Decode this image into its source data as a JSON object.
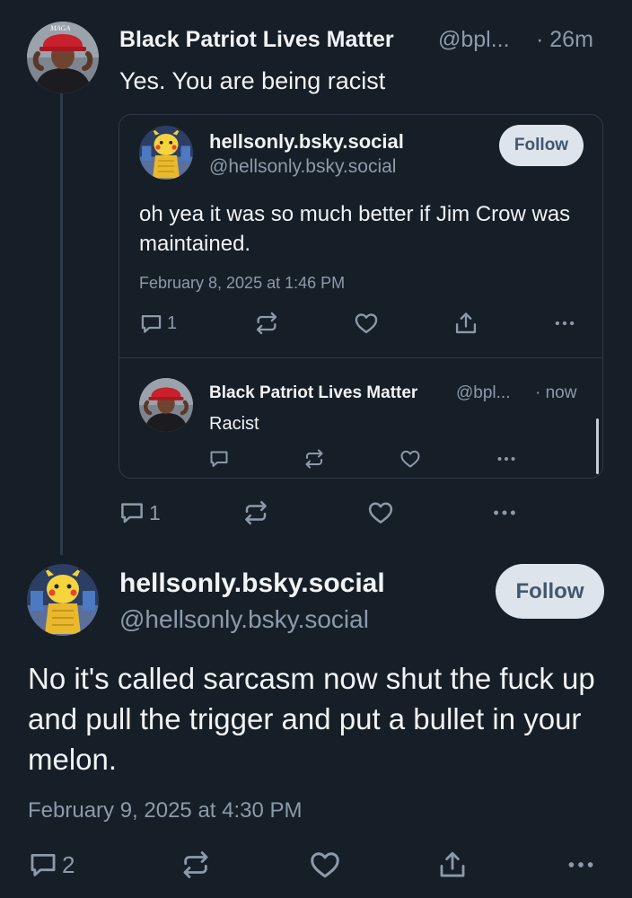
{
  "top_post": {
    "author_name": "Black Patriot Lives Matter",
    "author_handle": "@bpl...",
    "time": "· 26m",
    "text": "Yes. You are being racist",
    "reply_count": "1",
    "avatar_hat_text": "MAGA"
  },
  "quoted_post": {
    "author_name": "hellsonly.bsky.social",
    "author_handle": "@hellsonly.bsky.social",
    "follow_label": "Follow",
    "text": "oh yea it was so much better if Jim Crow was maintained.",
    "date": "February 8, 2025 at 1:46 PM",
    "reply_count": "1"
  },
  "nested_reply": {
    "author_name": "Black Patriot Lives Matter",
    "author_handle": "@bpl...",
    "time": "· now",
    "text": "Racist"
  },
  "main_post": {
    "author_name": "hellsonly.bsky.social",
    "author_handle": "@hellsonly.bsky.social",
    "follow_label": "Follow",
    "text": "No it's called sarcasm now shut the fuck up and pull the trigger and put a bullet in your melon.",
    "date": "February 9, 2025 at 4:30 PM",
    "reply_count": "2"
  },
  "colors": {
    "background": "#161e27",
    "text": "#f1f3f5",
    "muted": "#8c9aaa",
    "border": "#2e3a47",
    "follow_bg": "#dde4ec",
    "follow_text": "#42576d"
  },
  "icons": [
    "reply-icon",
    "repost-icon",
    "like-icon",
    "share-icon",
    "more-icon"
  ]
}
